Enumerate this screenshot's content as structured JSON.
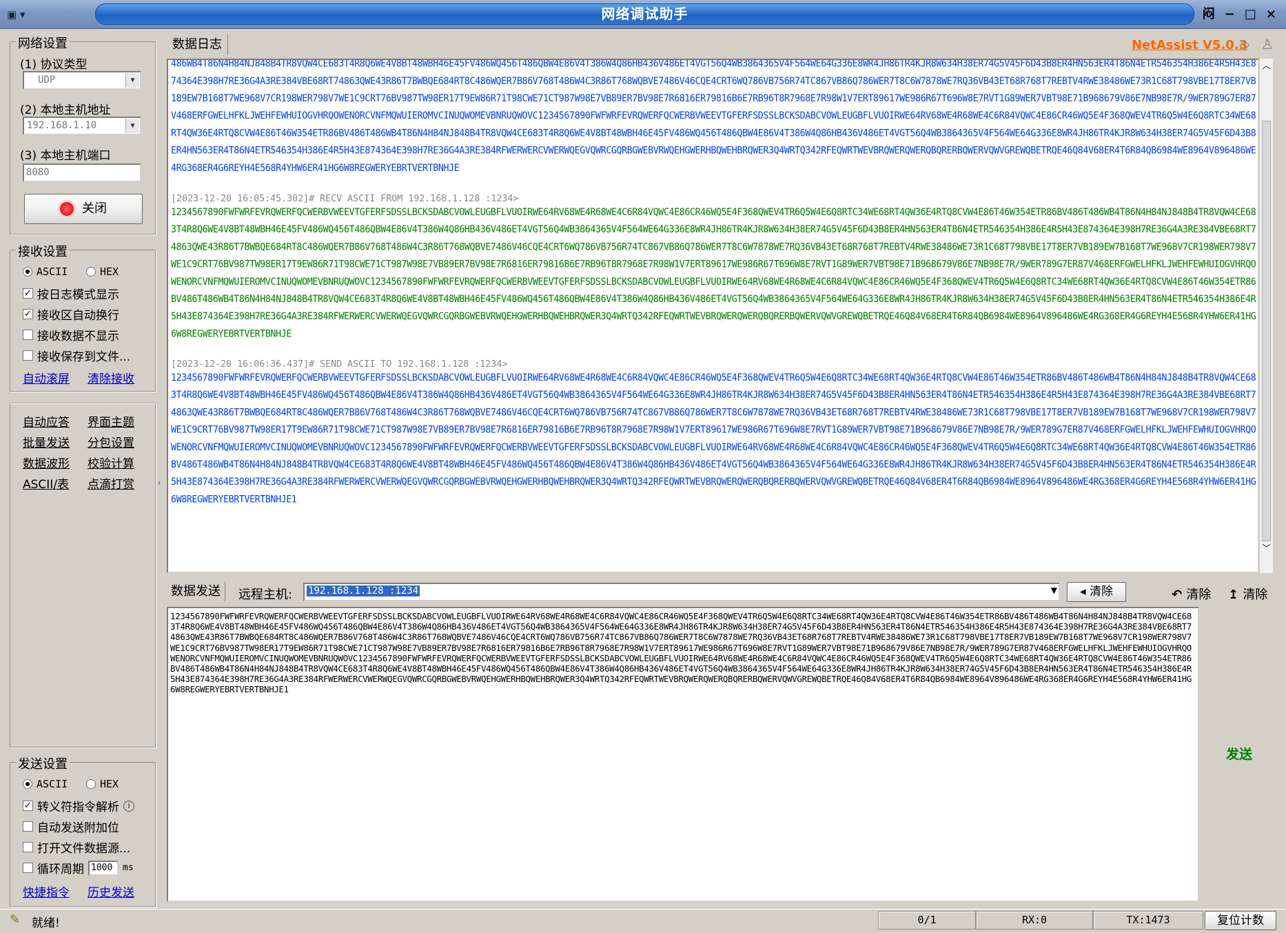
{
  "window": {
    "title": "网络调试助手",
    "controls": [
      "闷",
      "−",
      "□",
      "×"
    ],
    "menu_icon": "app-menu-icon"
  },
  "brand": {
    "label": "NetAssist V5.0.3",
    "color": "#ff6600"
  },
  "network_settings": {
    "title": "网络设置",
    "protocol_label": "(1) 协议类型",
    "protocol_value": "UDP",
    "host_label": "(2) 本地主机地址",
    "host_value": "192.168.1.10",
    "port_label": "(3) 本地主机端口",
    "port_value": "8080",
    "close_button": "关闭"
  },
  "receive_settings": {
    "title": "接收设置",
    "ascii": "ASCII",
    "hex": "HEX",
    "options": [
      {
        "label": "按日志模式显示",
        "checked": true
      },
      {
        "label": "接收区自动换行",
        "checked": true
      },
      {
        "label": "接收数据不显示",
        "checked": false
      },
      {
        "label": "接收保存到文件...",
        "checked": false
      }
    ],
    "auto_scroll": "自动滚屏",
    "clear_receive": "清除接收"
  },
  "tools": [
    [
      "自动应答",
      "界面主题"
    ],
    [
      "批量发送",
      "分包设置"
    ],
    [
      "数据波形",
      "校验计算"
    ],
    [
      "ASCII/表",
      "点滴打赏"
    ]
  ],
  "send_settings": {
    "title": "发送设置",
    "ascii": "ASCII",
    "hex": "HEX",
    "options": [
      {
        "label": "转义符指令解析",
        "checked": true
      },
      {
        "label": "自动发送附加位",
        "checked": false
      },
      {
        "label": "打开文件数据源...",
        "checked": false
      }
    ],
    "loop_label": "循环周期",
    "loop_value": "1000",
    "loop_unit": "ms",
    "shortcut": "快捷指令",
    "history": "历史发送"
  },
  "log_tab": "数据日志",
  "log_entries": [
    {
      "header": "",
      "kind": "send",
      "text": "486WB4T86N4H84NJ848B4TR8VQW4CE683T4R8Q6WE4V8BT48WBH46E45FV486WQ456T486QBW4E86V4T386W4Q86HB436V486ET4VGT56Q4WB3864365V4F564WE64G336E8WR4JH86TR4KJR8W634H38ER74G5V45F6D43B8ER4HN563ER4T86N4ETR546354H386E4R5H43E874364E398H7RE36G4A3RE384VBE68RT74863QWE43R86T7BWBQE684RT8C486WQER7B86V768T486W4C3R86T768WQBVE7486V46CQE4CRT6WQ786VB756R74TC867VB86Q786WER7T8C6W7878WE7RQ36VB43ET68R768T7REBTV4RWE38486WE73R1C68T798VBE17T8ER7VB189EW7B168T7WE968V7CR198WER798V7WE1C9CRT76BV987TW98ER17T9EW86R71T98CWE71CT987W98E7VB89ER7BV98E7R6816ER79816B6E7RB96T8R7968E7R98W1V7ERT89617WE986R67T696W8E7RVT1G89WER7VBT98E71B968679V86E7NB98E7R/9WER789G7ER87V468ERFGWELHFKLJWEHFEWHUIOGVHRQOWENORCVNFMQWUIEROMVCINUQWOMEVBNRUQWOVC1234567890FWFWRFEVRQWERFQCWERBVWEEVTGFERFSDSSLBCKSDABCVOWLEUGBFLVUOIRWE64RV68WE4R68WE4C6R84VQWC4E86CR46WQ5E4F368QWEV4TR6Q5W4E6Q8RTC34WE68RT4QW36E4RTQ8CVW4E86T46W354ETR86BV486T486WB4T86N4H84NJ848B4TR8VQW4CE683T4R8Q6WE4V8BT48WBH46E45FV486WQ456T486QBW4E86V4T386W4Q86HB436V486ET4VGT56Q4WB3864365V4F564WE64G336E8WR4JH86TR4KJR8W634H38ER74G5V45F6D43B8ER4HN563ER4T86N4ETR546354H386E4R5H43E874364E398H7RE36G4A3RE384RFWERWERCVWERWQEGVQWRCGQRBGWEBVRWQEHGWERHBQWEHBRQWER3Q4WRTQ342RFEQWRTWEVBRQWERQWERQBQRERBQWERVQWVGREWQBETRQE46Q84V68ER4T6R84QB6984WE8964V896486WE4RG368ER4G6REYH4E568R4YHW6ER41HG6W8REGWERYEBRTVERTBNHJE"
    },
    {
      "header": "[2023-12-20 16:05:45.302]# RECV ASCII FROM 192.168.1.128 :1234>",
      "kind": "recv",
      "text": "1234567890FWFWRFEVRQWERFQCWERBVWEEVTGFERFSDSSLBCKSDABCVOWLEUGBFLVUOIRWE64RV68WE4R68WE4C6R84VQWC4E86CR46WQ5E4F368QWEV4TR6Q5W4E6Q8RTC34WE68RT4QW36E4RTQ8CVW4E86T46W354ETR86BV486T486WB4T86N4H84NJ848B4TR8VQW4CE683T4R8Q6WE4V8BT48WBH46E45FV486WQ456T486QBW4E86V4T386W4Q86HB436V486ET4VGT56Q4WB3864365V4F564WE64G336E8WR4JH86TR4KJR8W634H38ER74G5V45F6D43B8ER4HN563ER4T86N4ETR546354H386E4R5H43E874364E398H7RE36G4A3RE384VBE68RT74863QWE43R86T7BWBQE684RT8C486WQER7B86V768T486W4C3R86T768WQBVE7486V46CQE4CRT6WQ786VB756R74TC867VB86Q786WER7T8C6W7878WE7RQ36VB43ET68R768T7REBTV4RWE38486WE73R1C68T798VBE17T8ER7VB189EW7B168T7WE968V7CR198WER798V7WE1C9CRT76BV987TW98ER17T9EW86R71T98CWE71CT987W98E7VB89ER7BV98E7R6816ER79816B6E7RB96T8R7968E7R98W1V7ERT89617WE986R67T696W8E7RVT1G89WER7VBT98E71B968679V86E7NB98E7R/9WER789G7ER87V468ERFGWELHFKLJWEHFEWHUIOGVHRQOWENORCVNFMQWUIEROMVCINUQWOMEVBNRUQWOVC1234567890FWFWRFEVRQWERFQCWERBVWEEVTGFERFSDSSLBCKSDABCVOWLEUGBFLVUOIRWE64RV68WE4R68WE4C6R84VQWC4E86CR46WQ5E4F368QWEV4TR6Q5W4E6Q8RTC34WE68RT4QW36E4RTQ8CVW4E86T46W354ETR86BV486T486WB4T86N4H84NJ848B4TR8VQW4CE683T4R8Q6WE4V8BT48WBH46E45FV486WQ456T486QBW4E86V4T386W4Q86HB436V486ET4VGT56Q4WB3864365V4F564WE64G336E8WR4JH86TR4KJR8W634H38ER74G5V45F6D43B8ER4HN563ER4T86N4ETR546354H386E4R5H43E874364E398H7RE36G4A3RE384RFWERWERCVWERWQEGVQWRCGQRBGWEBVRWQEHGWERHBQWEHBRQWER3Q4WRTQ342RFEQWRTWEVBRQWERQWERQBQRERBQWERVQWVGREWQBETRQE46Q84V68ER4T6R84QB6984WE8964V896486WE4RG368ER4G6REYH4E568R4YHW6ER41HG6W8REGWERYEBRTVERTBNHJE"
    },
    {
      "header": "[2023-12-20 16:06:36.437]# SEND ASCII TO 192.168.1.128 :1234>",
      "kind": "send",
      "text": "1234567890FWFWRFEVRQWERFQCWERBVWEEVTGFERFSDSSLBCKSDABCVOWLEUGBFLVUOIRWE64RV68WE4R68WE4C6R84VQWC4E86CR46WQ5E4F368QWEV4TR6Q5W4E6Q8RTC34WE68RT4QW36E4RTQ8CVW4E86T46W354ETR86BV486T486WB4T86N4H84NJ848B4TR8VQW4CE683T4R8Q6WE4V8BT48WBH46E45FV486WQ456T486QBW4E86V4T386W4Q86HB436V486ET4VGT56Q4WB3864365V4F564WE64G336E8WR4JH86TR4KJR8W634H38ER74G5V45F6D43B8ER4HN563ER4T86N4ETR546354H386E4R5H43E874364E398H7RE36G4A3RE384VBE68RT74863QWE43R86T7BWBQE684RT8C486WQER7B86V768T486W4C3R86T768WQBVE7486V46CQE4CRT6WQ786VB756R74TC867VB86Q786WER7T8C6W7878WE7RQ36VB43ET68R768T7REBTV4RWE38486WE73R1C68T798VBE17T8ER7VB189EW7B168T7WE968V7CR198WER798V7WE1C9CRT76BV987TW98ER17T9EW86R71T98CWE71CT987W98E7VB89ER7BV98E7R6816ER79816B6E7RB96T8R7968E7R98W1V7ERT89617WE986R67T696W8E7RVT1G89WER7VBT98E71B968679V86E7NB98E7R/9WER789G7ER87V468ERFGWELHFKLJWEHFEWHUIOGVHRQOWENORCVNFMQWUIEROMVCINUQWOMEVBNRUQWOVC1234567890FWFWRFEVRQWERFQCWERBVWEEVTGFERFSDSSLBCKSDABCVOWLEUGBFLVUOIRWE64RV68WE4R68WE4C6R84VQWC4E86CR46WQ5E4F368QWEV4TR6Q5W4E6Q8RTC34WE68RT4QW36E4RTQ8CVW4E86T46W354ETR86BV486T486WB4T86N4H84NJ848B4TR8VQW4CE683T4R8Q6WE4V8BT48WBH46E45FV486WQ456T486QBW4E86V4T386W4Q86HB436V486ET4VGT56Q4WB3864365V4F564WE64G336E8WR4JH86TR4KJR8W634H38ER74G5V45F6D43B8ER4HN563ER4T86N4ETR546354H386E4R5H43E874364E398H7RE36G4A3RE384RFWERWERCVWERWQEGVQWRCGQRBGWEBVRWQEHGWERHBQWEHBRQWER3Q4WRTQ342RFEQWRTWEVBRQWERQWERQBQRERBQWERVQWVGREWQBETRQE46Q84V68ER4T6R84QB6984WE8964V896486WE4RG368ER4G6REYH4E568R4YHW6ER41HG6W8REGWERYEBRTVERTBNHJE1"
    }
  ],
  "send_area": {
    "tab": "数据发送",
    "remote_label": "远程主机:",
    "remote_value": "192.168.1.128 :1234",
    "clear_btn": "清除",
    "clear1": "清除",
    "clear2": "清除",
    "send_btn": "发送",
    "text": "1234567890FWFWRFEVRQWERFQCWERBVWEEVTGFERFSDSSLBCKSDABCVOWLEUGBFLVUOIRWE64RV68WE4R68WE4C6R84VQWC4E86CR46WQ5E4F368QWEV4TR6Q5W4E6Q8RTC34WE68RT4QW36E4RTQ8CVW4E86T46W354ETR86BV486T486WB4T86N4H84NJ848B4TR8VQW4CE683T4R8Q6WE4V8BT48WBH46E45FV486WQ456T486QBW4E86V4T386W4Q86HB436V486ET4VGT56Q4WB3864365V4F564WE64G336E8WR4JH86TR4KJR8W634H38ER74G5V45F6D43B8ER4HN563ER4T86N4ETR546354H386E4R5H43E874364E398H7RE36G4A3RE384VBE68RT74863QWE43R86T7BWBQE684RT8C486WQER7B86V768T486W4C3R86T768WQBVE7486V46CQE4CRT6WQ786VB756R74TC867VB86Q786WER7T8C6W7878WE7RQ36VB43ET68R768T7REBTV4RWE38486WE73R1C68T798VBE17T8ER7VB189EW7B168T7WE968V7CR198WER798V7WE1C9CRT76BV987TW98ER17T9EW86R71T98CWE71CT987W98E7VB89ER7BV98E7R6816ER79816B6E7RB96T8R7968E7R98W1V7ERT89617WE986R67T696W8E7RVT1G89WER7VBT98E71B968679V86E7NB98E7R/9WER789G7ER87V468ERFGWELHFKLJWEHFEWHUIOGVHRQOWENORCVNFMQWUIEROMVCINUQWOMEVBNRUQWOVC1234567890FWFWRFEVRQWERFQCWERBVWEEVTGFERFSDSSLBCKSDABCVOWLEUGBFLVUOIRWE64RV68WE4R68WE4C6R84VQWC4E86CR46WQ5E4F368QWEV4TR6Q5W4E6Q8RTC34WE68RT4QW36E4RTQ8CVW4E86T46W354ETR86BV486T486WB4T86N4H84NJ848B4TR8VQW4CE683T4R8Q6WE4V8BT48WBH46E45FV486WQ456T486QBW4E86V4T386W4Q86HB436V486ET4VGT56Q4WB3864365V4F564WE64G336E8WR4JH86TR4KJR8W634H38ER74G5V45F6D43B8ER4HN563ER4T86N4ETR546354H386E4R5H43E874364E398H7RE36G4A3RE384RFWERWERCVWERWQEGVQWRCGQRBGWEBVRWQEHGWERHBQWEHBRQWER3Q4WRTQ342RFEQWRTWEVBRQWERQWERQBQRERBQWERVQWVGREWQBETRQE46Q84V68ER4T6R84QB6984WE8964V896486WE4RG368ER4G6REYH4E568R4YHW6ER41HG6W8REGWERYEBRTVERTBNHJE1"
  },
  "status": {
    "ready": "就绪!",
    "count": "0/1",
    "rx": "RX:0",
    "tx": "TX:1473",
    "reset": "复位计数"
  }
}
